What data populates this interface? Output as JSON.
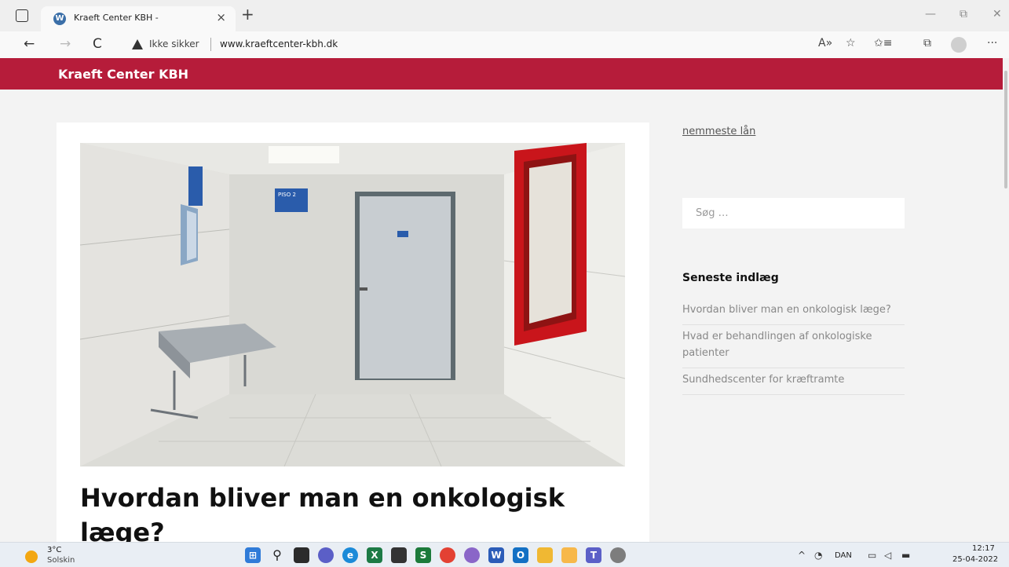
{
  "browser": {
    "tab_title": "Kraeft Center KBH -",
    "tab_close": "×",
    "new_tab": "+",
    "minimize": "—",
    "restore": "⧉",
    "close": "✕",
    "back": "←",
    "forward": "→",
    "refresh": "C",
    "security_text": "Ikke sikker",
    "url": "www.kraeftcenter-kbh.dk",
    "read_aloud": "A»",
    "add_favorite": "☆",
    "favorites": "✩≡",
    "collections": "⧉",
    "more": "···"
  },
  "site": {
    "title": "Kraeft Center KBH",
    "brand_color": "#b61c3a"
  },
  "article": {
    "title": "Hvordan bliver man en onkologisk læge?",
    "image_sign": "PISO 2"
  },
  "sidebar": {
    "link": "nemmeste lån",
    "search_placeholder": "Søg …",
    "recent_title": "Seneste indlæg",
    "recent_posts": [
      "Hvordan bliver man en onkologisk læge?",
      "Hvad er behandlingen af onkologiske patienter",
      "Sundhedscenter for kræftramte"
    ]
  },
  "taskbar": {
    "temperature": "3°C",
    "weather": "Solskin",
    "language": "DAN",
    "time": "12:17",
    "date": "25-04-2022",
    "tray_chevron": "^"
  }
}
